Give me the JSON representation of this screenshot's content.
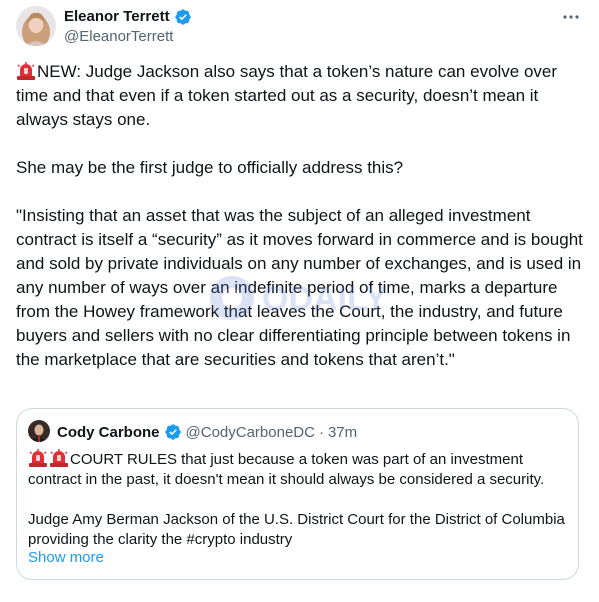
{
  "tweet": {
    "author": {
      "display_name": "Eleanor Terrett",
      "handle": "@EleanorTerrett",
      "verified": true
    },
    "more_icon": "more-horizontal-icon",
    "paragraphs": [
      "NEW: Judge Jackson also says that a token’s nature can evolve over time and that even if a token started out as a security, doesn’t mean it always stays one.",
      "She may be the first judge to officially address this?",
      "\"Insisting that an asset that was the subject of an alleged investment contract is itself a “security” as it moves forward in commerce and is bought and sold by private individuals on any number of exchanges, and is used in any number of ways over an indefinite period of time, marks a departure from the Howey framework that leaves the Court, the industry, and future buyers and sellers with no clear differentiating principle between tokens in the marketplace that are securities and tokens that aren’t.\""
    ],
    "lead_emoji": "siren-icon"
  },
  "quote": {
    "author": {
      "display_name": "Cody Carbone",
      "handle": "@CodyCarboneDC",
      "separator": "·",
      "time": "37m",
      "verified": true
    },
    "paragraphs": [
      "COURT RULES that just because a token was part of an investment contract in the past, it doesn't mean it should always be considered a security.",
      "Judge Amy Berman Jackson of the U.S. District Court for the District of Columbia providing the clarity the #crypto industry"
    ],
    "lead_emojis": [
      "siren-icon",
      "siren-icon"
    ],
    "show_more_label": "Show more"
  },
  "watermark": {
    "text": "ODAILY"
  },
  "colors": {
    "text_primary": "#0f1419",
    "text_secondary": "#536471",
    "link": "#1d9bf0",
    "verified_badge": "#1d9bf0",
    "border": "#cfd9de",
    "siren_red": "#e0303a"
  }
}
